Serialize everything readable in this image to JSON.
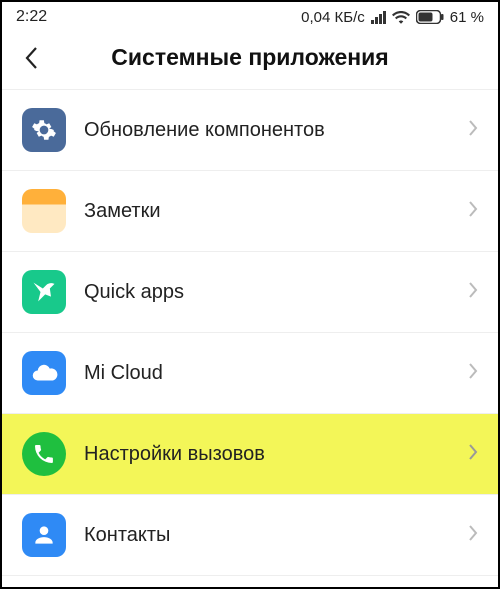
{
  "status": {
    "time": "2:22",
    "net_speed": "0,04 КБ/с",
    "battery_pct": "61 %"
  },
  "header": {
    "title": "Системные приложения"
  },
  "items": [
    {
      "id": "component-update",
      "label": "Обновление компонентов",
      "icon": "gear-icon",
      "highlight": false
    },
    {
      "id": "notes",
      "label": "Заметки",
      "icon": "notes-icon",
      "highlight": false
    },
    {
      "id": "quick-apps",
      "label": "Quick apps",
      "icon": "bird-icon",
      "highlight": false
    },
    {
      "id": "mi-cloud",
      "label": "Mi Cloud",
      "icon": "cloud-icon",
      "highlight": false
    },
    {
      "id": "call-settings",
      "label": "Настройки вызовов",
      "icon": "phone-icon",
      "highlight": true
    },
    {
      "id": "contacts",
      "label": "Контакты",
      "icon": "person-icon",
      "highlight": false
    }
  ]
}
